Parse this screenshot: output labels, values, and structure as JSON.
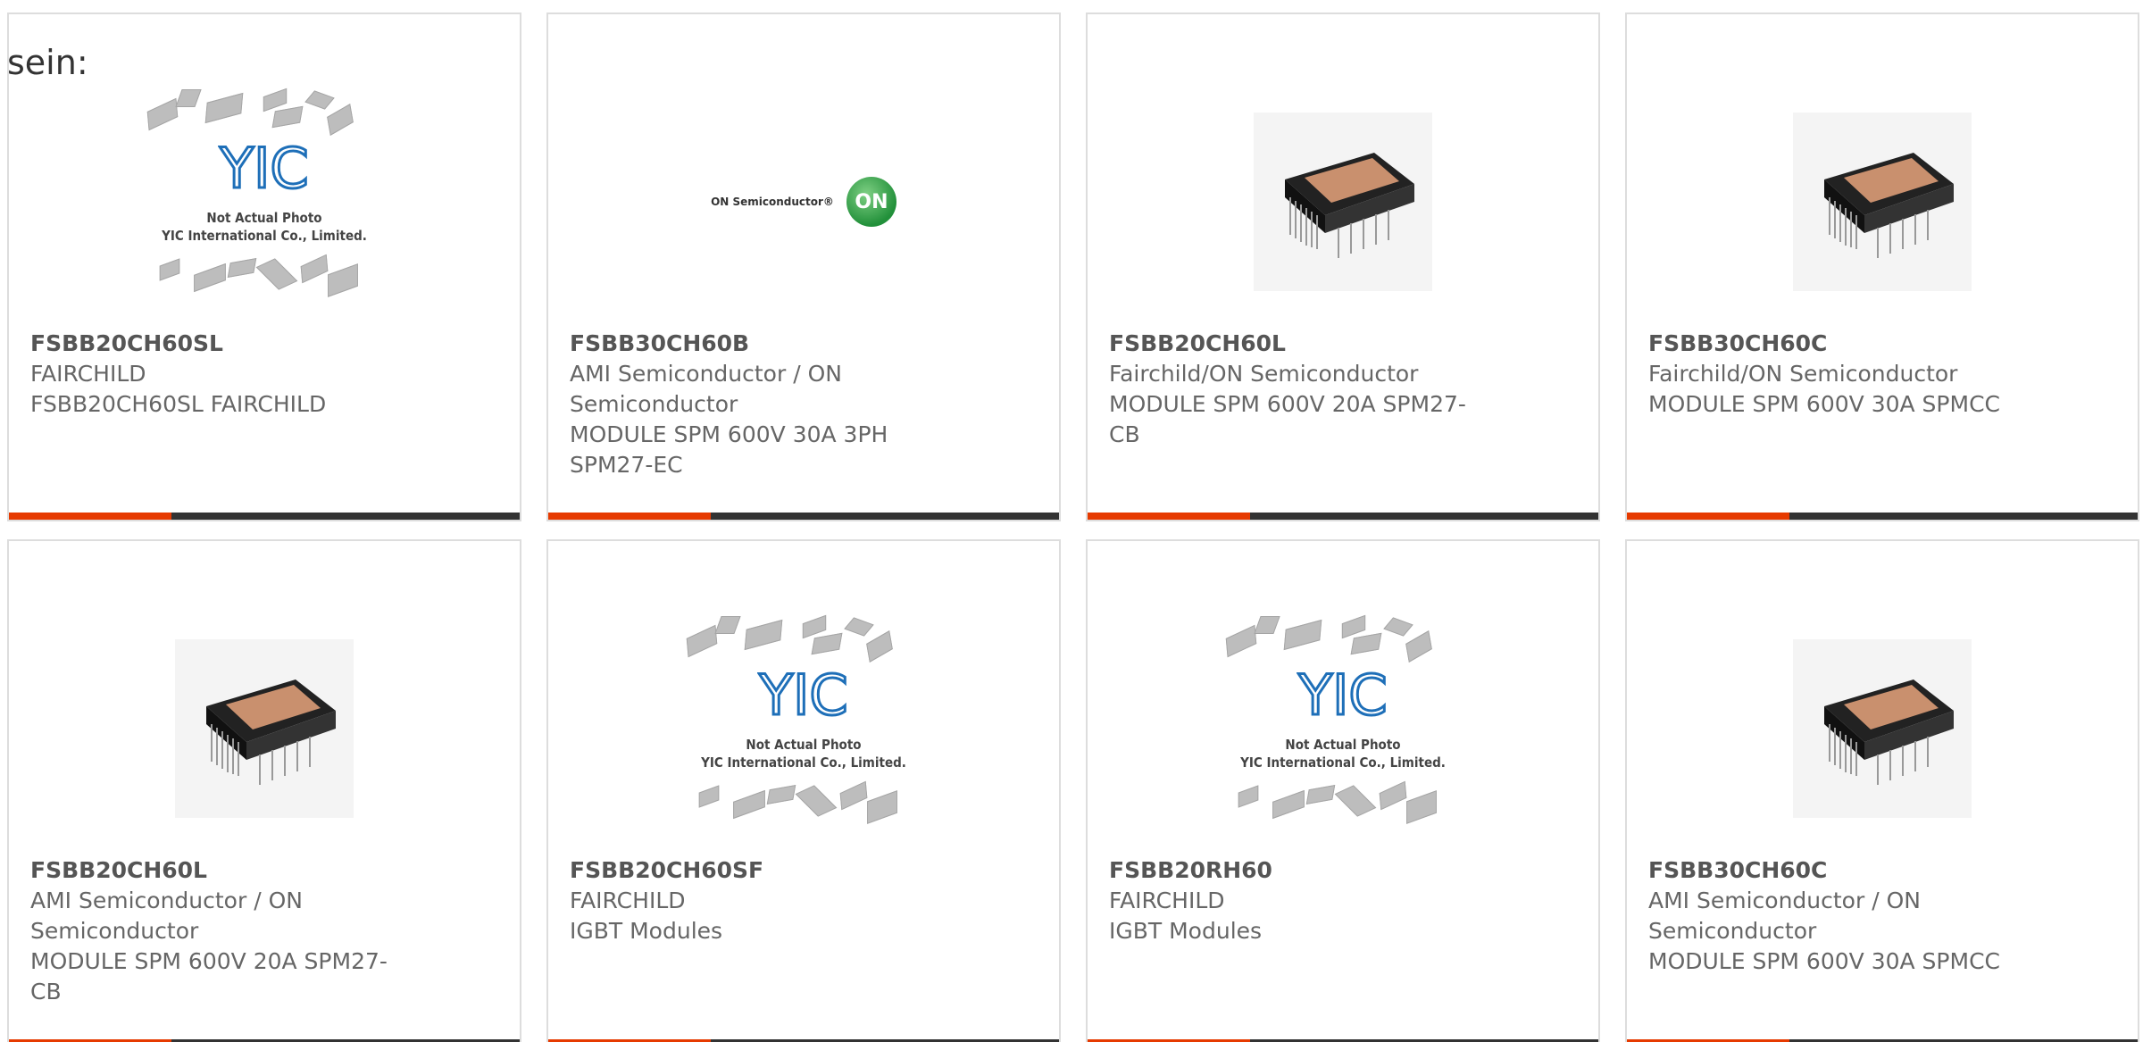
{
  "intro_text": "sein:",
  "placeholder": {
    "brand": "YIC",
    "note_line1": "Not Actual Photo",
    "note_line2": "YIC International Co., Limited."
  },
  "on_logo": {
    "text": "ON Semiconductor®",
    "mark": "ON"
  },
  "colors": {
    "accent": "#e63a00",
    "bar": "#333333",
    "border": "#dddddd"
  },
  "products": [
    {
      "part": "FSBB20CH60SL",
      "maker_lines": [
        "FAIRCHILD"
      ],
      "desc_lines": [
        "FSBB20CH60SL FAIRCHILD"
      ],
      "image": "placeholder"
    },
    {
      "part": "FSBB30CH60B",
      "maker_lines": [
        "AMI Semiconductor / ON",
        "Semiconductor"
      ],
      "desc_lines": [
        "MODULE SPM 600V 30A 3PH",
        "SPM27-EC"
      ],
      "image": "on-logo"
    },
    {
      "part": "FSBB20CH60L",
      "maker_lines": [
        "Fairchild/ON Semiconductor"
      ],
      "desc_lines": [
        "MODULE SPM 600V 20A SPM27-",
        "CB"
      ],
      "image": "module"
    },
    {
      "part": "FSBB30CH60C",
      "maker_lines": [
        "Fairchild/ON Semiconductor"
      ],
      "desc_lines": [
        "MODULE SPM 600V 30A SPMCC"
      ],
      "image": "module"
    },
    {
      "part": "FSBB20CH60L",
      "maker_lines": [
        "AMI Semiconductor / ON",
        "Semiconductor"
      ],
      "desc_lines": [
        "MODULE SPM 600V 20A SPM27-",
        "CB"
      ],
      "image": "module"
    },
    {
      "part": "FSBB20CH60SF",
      "maker_lines": [
        "FAIRCHILD"
      ],
      "desc_lines": [
        "IGBT Modules"
      ],
      "image": "placeholder"
    },
    {
      "part": "FSBB20RH60",
      "maker_lines": [
        "FAIRCHILD"
      ],
      "desc_lines": [
        "IGBT Modules"
      ],
      "image": "placeholder"
    },
    {
      "part": "FSBB30CH60C",
      "maker_lines": [
        "AMI Semiconductor / ON",
        "Semiconductor"
      ],
      "desc_lines": [
        "MODULE SPM 600V 30A SPMCC"
      ],
      "image": "module"
    }
  ]
}
